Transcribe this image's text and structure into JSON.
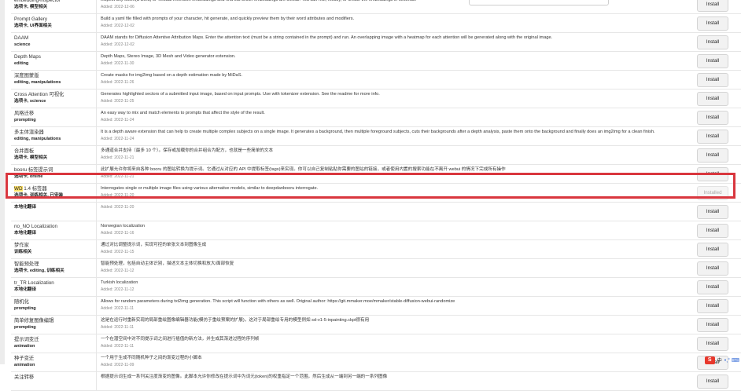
{
  "buttons": {
    "install_label": "Install",
    "installed_label": "Installed"
  },
  "rows": [
    {
      "name": "embedding-inspector",
      "tags": "选项卡, 模型相关",
      "desc": "Inspect any token(a word) or Textual-Inversion embeddings and find out which embeddings are similar. You can mix, modify, or create the embeddings in seconds.",
      "added": "Added: 2022-12-06",
      "button": "Install"
    },
    {
      "name": "Prompt Gallery",
      "tags": "选项卡, UI界面相关",
      "desc": "Build a yaml file filled with prompts of your character, hit generate, and quickly preview them by their word attributes and modifiers.",
      "added": "Added: 2022-12-02",
      "button": "Install"
    },
    {
      "name": "DAAM",
      "tags": "science",
      "desc": "DAAM stands for Diffusion Attentive Attribution Maps. Enter the attention text (must be a string contained in the prompt) and run. An overlapping image with a heatmap for each attention will be generated along with the original image.",
      "added": "Added: 2022-12-02",
      "button": "Install"
    },
    {
      "name": "Depth Maps",
      "tags": "editing",
      "desc": "Depth Maps, Stereo Image, 3D Mesh and Video generator extension.",
      "added": "Added: 2022-11-30",
      "button": "Install"
    },
    {
      "name": "深度图蒙版",
      "tags": "editing, manipulations",
      "desc": "Create masks for img2img based on a depth estimation made by MiDaS.",
      "added": "Added: 2022-11-26",
      "button": "Install"
    },
    {
      "name": "Cross Attention 可视化",
      "tags": "选项卡, science",
      "desc": "Generates highlighted sectors of a submitted input image, based on input prompts. Use with tokenizer extension. See the readme for more info.",
      "added": "Added: 2022-11-25",
      "button": "Install"
    },
    {
      "name": "风格迁移",
      "tags": "prompting",
      "desc": "An easy way to mix and match elements to prompts that affect the style of the result.",
      "added": "Added: 2022-11-24",
      "button": "Install"
    },
    {
      "name": "多主体渲染器",
      "tags": "editing, manipulations",
      "desc": "It is a depth aware extension that can help to create multiple complex subjects on a single image. It generates a background, then multiple foreground subjects, cuts their backgrounds after a depth analysis, paste them onto the background and finally does an img2img for a clean finish.",
      "added": "Added: 2022-11-24",
      "button": "Install"
    },
    {
      "name": "合并面板",
      "tags": "选项卡, 模型相关",
      "desc": "多通道合并支持（最多 10 个）。保存或加载你的合并组合为配方，也就是一些简单的文本",
      "added": "Added: 2022-11-21",
      "button": "Install"
    },
    {
      "name": "booru 标签提示词",
      "tags": "选项卡, online",
      "desc": "此扩展允许你将来自各种 booru 的图站转换为提示词。它通过从对应的 API 中提取标签(tags)来实现。你可以自己复制粘贴你需要的图站的链接，或者使用内置的搜索功能在不离开 webui 的情况下完成所有操作",
      "added": "Added: 2022-11-21",
      "button": "Install"
    },
    {
      "name_prefix": "WD",
      "name": " 1.4 标签器",
      "tags": "选项卡, 训练相关, 已安装",
      "desc": "Interrogates single or multiple image files using various alternative models, similar to deepdanbooru interrogate.",
      "added": "Added: 2022-11-20",
      "button": "Installed"
    },
    {
      "name": "",
      "tags": "本地化翻译",
      "desc": "",
      "added": "Added: 2022-11-20",
      "button": "Install"
    },
    {
      "name": "no_NO Localization",
      "tags": "本地化翻译",
      "desc": "Norwegian localization",
      "added": "Added: 2022-11-16",
      "button": "Install"
    },
    {
      "name": "梦作家",
      "tags": "训练相关",
      "desc": "通过对比调整提示词，实现可控的单张文本到图像生成",
      "added": "Added: 2022-11-15",
      "button": "Install"
    },
    {
      "name": "智能预处理",
      "tags": "选项卡, editing, 训练相关",
      "desc": "智能预处理，包括自动主体识别，描述文本主体切换和放大/面部恢复",
      "added": "Added: 2022-11-12",
      "button": "Install"
    },
    {
      "name": "tr_TR Localization",
      "tags": "本地化翻译",
      "desc": "Turkish localization",
      "added": "Added: 2022-11-12",
      "button": "Install"
    },
    {
      "name": "随机化",
      "tags": "prompting",
      "desc": "Allows for random parameters during txt2img generation. This script will function with others as well. Original author: https://git.mmaker.moe/mmaker/stable-diffusion-webui-randomize",
      "added": "Added: 2022-11-11",
      "button": "Install"
    },
    {
      "name": "简单修复图像编辑",
      "tags": "prompting",
      "desc": "这是在运行时重新实现的局部重绘图像编辑器功能(模仿于重绘预案的扩展)，这对于局部重绘专用的模型例如 sd-v1-5-inpainting.ckpt很有用",
      "added": "Added: 2022-11-11",
      "button": "Install"
    },
    {
      "name": "提示词变迁",
      "tags": "animation",
      "desc": "一个在潜空间中对不同提示词之间进行插值的新方法，并生成其渐进过程的序列帧",
      "added": "Added: 2022-11-11",
      "button": "Install"
    },
    {
      "name": "种子变迁",
      "tags": "animation",
      "desc": "一个用于生成不同随机种子之间的渐变过程的小脚本",
      "added": "Added: 2022-11-09",
      "button": "Install"
    },
    {
      "name": "关注转移",
      "tags": "",
      "desc": "根据提示词生成一系列关注度渐变的图像。此脚本允许你修改在提示词中为词元(token)的权重指定一个范围，然后生成从一端到另一端的一系列图像",
      "added": "",
      "button": "Install"
    }
  ],
  "tray": {
    "logo": "S",
    "lang": "中",
    "glyphs": "•,° ⌨"
  }
}
